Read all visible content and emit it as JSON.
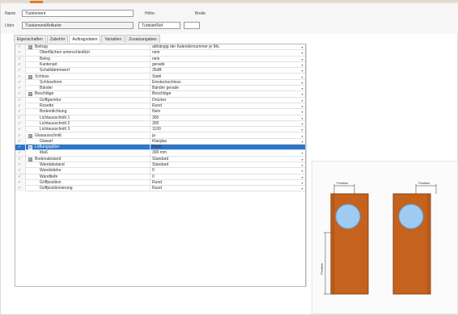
{
  "header": {
    "row1": {
      "label_a": "Name",
      "field_a": "Türelement",
      "label_b": "Höhe",
      "label_c": "Breite"
    },
    "row2": {
      "label_a": "Lfdnr",
      "field_a": "Türelement/Artikelnr",
      "field_b": "Türblatt/Ref",
      "field_c": ""
    }
  },
  "tabs": [
    "Eigenschaften",
    "Zubehör",
    "Auftragsdaten",
    "Variablen",
    "Zusatzangaben"
  ],
  "grid": {
    "rows": [
      {
        "tick": "✓",
        "expander": "⊞",
        "name": "Beitrag",
        "value": "abhängig der Kalendernummer je Mo.",
        "dropdown": true
      },
      {
        "tick": "✓",
        "expander": "",
        "name": "Oberflächen unterschiedlich",
        "value": "nein",
        "dropdown": true
      },
      {
        "tick": "✓",
        "expander": "",
        "name": "Beleg",
        "value": "nein",
        "dropdown": true
      },
      {
        "tick": "✓",
        "expander": "",
        "name": "Kantenart",
        "value": "gerade",
        "dropdown": true
      },
      {
        "tick": "✓",
        "expander": "",
        "name": "Schalldämmwert",
        "value": "35dB",
        "dropdown": true
      },
      {
        "tick": "✓",
        "expander": "⊞",
        "name": "Schloss",
        "value": "Stahl",
        "dropdown": true
      },
      {
        "tick": "✓",
        "expander": "",
        "name": "Schlossform",
        "value": "Einsteckschloss",
        "dropdown": true
      },
      {
        "tick": "✓",
        "expander": "",
        "name": "Bänder",
        "value": "Bänder gerade",
        "dropdown": true
      },
      {
        "tick": "✓",
        "expander": "⊞",
        "name": "Beschläge",
        "value": "Beschläge",
        "dropdown": true
      },
      {
        "tick": "✓",
        "expander": "",
        "name": "Griffgarnitur",
        "value": "Drücker",
        "dropdown": true
      },
      {
        "tick": "✓",
        "expander": "",
        "name": "Rosette",
        "value": "Rund",
        "dropdown": true
      },
      {
        "tick": "✓",
        "expander": "",
        "name": "Bodendichtung",
        "value": "Nein",
        "dropdown": true
      },
      {
        "tick": "✓",
        "expander": "",
        "name": "Lichtausschnitt 1",
        "value": "300",
        "dropdown": true
      },
      {
        "tick": "✓",
        "expander": "",
        "name": "Lichtausschnitt 2",
        "value": "300",
        "dropdown": true
      },
      {
        "tick": "✓",
        "expander": "",
        "name": "Lichtausschnitt 3",
        "value": "1100",
        "dropdown": true
      },
      {
        "tick": "✓",
        "expander": "⊞",
        "name": "Glasausschnitt",
        "value": "ja",
        "dropdown": true
      },
      {
        "tick": "✓",
        "expander": "",
        "name": "Glasart",
        "value": "Klarglas",
        "dropdown": true
      },
      {
        "tick": "✓",
        "expander": "⊞",
        "name": "Lüftungsgitter",
        "value": "Rund",
        "dropdown": true,
        "selected": true
      },
      {
        "tick": "✓",
        "expander": "",
        "name": "Maß",
        "value": "300 mm",
        "dropdown": true
      },
      {
        "tick": "✓",
        "expander": "⊞",
        "name": "Bodenabstand",
        "value": "Standard",
        "dropdown": true
      },
      {
        "tick": "✓",
        "expander": "",
        "name": "Wandabstand",
        "value": "Standard",
        "dropdown": true
      },
      {
        "tick": "✓",
        "expander": "",
        "name": "Wandstärke",
        "value": "0",
        "dropdown": true
      },
      {
        "tick": "✓",
        "expander": "",
        "name": "Wandtiefe",
        "value": "0",
        "dropdown": true
      },
      {
        "tick": "✓",
        "expander": "",
        "name": "Griffposition",
        "value": "Rund",
        "dropdown": true
      },
      {
        "tick": "✓",
        "expander": "",
        "name": "Griffpositionierung",
        "value": "Rund",
        "dropdown": true
      }
    ]
  },
  "preview": {
    "label_left": "Position",
    "label_right": "Position",
    "label_vertical": "Position"
  },
  "colors": {
    "door": "#c4621e",
    "door_edge": "#8a4416",
    "window": "#9ecbf2",
    "window_stroke": "#6a9cc6",
    "selection": "#2e76c9",
    "tick": "#3fa53f"
  },
  "icons": {
    "tick": "checkmark-icon",
    "expander": "expand-plus-icon",
    "dropdown": "dropdown-arrow-icon"
  }
}
